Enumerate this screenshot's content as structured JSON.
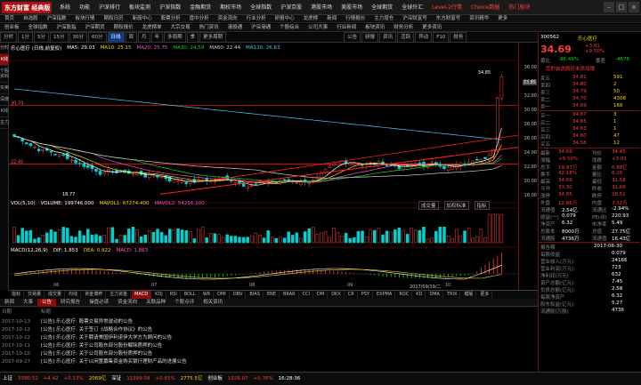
{
  "app": {
    "logo": "东方财富 经典版"
  },
  "menu": {
    "items": [
      "系统",
      "功能",
      "沪深排行",
      "板块监测",
      "沪深指数",
      "金融期货",
      "期权市场",
      "全球指数",
      "沪深京股",
      "港股市场",
      "美股市场",
      "全球期货",
      "全球外汇",
      "Level-2行情",
      "Choice数据",
      "热门版块"
    ],
    "system_items": [
      "选股器",
      "设置",
      "至尊版"
    ]
  },
  "nav": {
    "row1": [
      "首页",
      "自选股",
      "沪深指数",
      "板块行情",
      "期权日历",
      "新股中心",
      "股票分析",
      "盘中分析",
      "资金流向",
      "行业分析",
      "研报中心",
      "龙虎榜",
      "新闻",
      "行情报价",
      "主力增仓",
      "沪深财富号",
      "东方财富号",
      "资讯精华",
      "更多"
    ],
    "row2": [
      "创业板",
      "全球指数",
      "沪深股指",
      "沪深期货",
      "期权报价",
      "龙虎榜单",
      "大宗交易",
      "热门资讯",
      "港股通",
      "沪深港通",
      "个股综合",
      "公司大事",
      "行业新闻",
      "板块资讯",
      "财务分析",
      "更多资讯"
    ]
  },
  "toolbar": {
    "items": [
      "分时",
      "1分",
      "5分",
      "15分",
      "30分",
      "60分",
      "日线",
      "周",
      "月",
      "年",
      "多周期",
      "季",
      "更多周期"
    ],
    "active": "日线",
    "search_tabs": [
      "公告",
      "研报",
      "资讯",
      "活跃",
      "异动",
      "F10",
      "财务"
    ]
  },
  "sidetabs": [
    "分时",
    "K线",
    "个股资料",
    "买卖",
    "深度",
    "K线",
    "主力"
  ],
  "legend": {
    "name": "乐心医疗 (日线,前复权)",
    "ma": [
      {
        "label": "MA5:",
        "value": "29.03"
      },
      {
        "label": "MA10:",
        "value": "25.15"
      },
      {
        "label": "MA20:",
        "value": "25.75"
      },
      {
        "label": "MA30:",
        "value": "24.59"
      },
      {
        "label": "MA60:",
        "value": "22.44"
      },
      {
        "label": "MA120:",
        "value": "26.63"
      }
    ]
  },
  "vol_legend": {
    "name": "VOL(5,10)",
    "vol": "VOLUME: 199746.000",
    "ma1": "MAVOL1: 67274.400",
    "ma2": "MAVOL2: 54256.100"
  },
  "macd_legend": {
    "name": "MACD(12,26,9)",
    "dif": "DIF: 1.853",
    "dea": "DEA: 0.922",
    "macd": "MACD: 1.863"
  },
  "price_axis": [
    "36.00",
    "34.00",
    "32.00",
    "30.00",
    "28.00",
    "26.00",
    "24.00",
    "22.00",
    "20.00",
    "18.00"
  ],
  "high_label": "34.85",
  "low_label": "18.77",
  "current_price_tag": "33.85",
  "red_line_labels": [
    "30.70",
    "22.45"
  ],
  "chart_date": "2017/09/19/二",
  "xaxis_labels": [
    "06",
    "07",
    "08",
    "09",
    "10"
  ],
  "btabs": [
    "指标",
    "交易量",
    "成交量",
    "均线",
    "资金博弈",
    "主力资金",
    "MACD",
    "KDJ",
    "RSI",
    "BOLL",
    "WR",
    "DMI",
    "OBV",
    "BIAS",
    "ENE",
    "BRAR",
    "CCI",
    "DM",
    "DKX",
    "CR",
    "PSY",
    "EXPMA",
    "ROC",
    "KD",
    "DMA",
    "TRIX",
    "模版",
    "更多"
  ],
  "sub_tabs_vol": [
    "成交量",
    "加权标准",
    "指标"
  ],
  "news_tabs": [
    "新闻",
    "大事",
    "公告",
    "研究报告",
    "操盘必读",
    "资金流向",
    "关联品种",
    "个股点评",
    "相关资讯"
  ],
  "news_active": "公告",
  "news_header": [
    "日期",
    "标题"
  ],
  "news": [
    {
      "date": "2017-10-13",
      "title": "[公告] 乐心医疗: 股票交易异常波动的公告"
    },
    {
      "date": "2017-10-12",
      "title": "[公告] 乐心医疗: 关于签订《战略合作协议》的公告"
    },
    {
      "date": "2017-10-12",
      "title": "[公告] 乐心医疗: 关于聘请美国伊利诺伊大学方为顾问的公告"
    },
    {
      "date": "2017-10-11",
      "title": "[公告] 乐心医疗: 关于公司股东部分股份解除质押的公告"
    },
    {
      "date": "2017-10-10",
      "title": "[公告] 乐心医疗: 关于公司股东部分股份质押的公告"
    },
    {
      "date": "2017-09-27",
      "title": "[公告] 乐心医疗: 关于以闲置募集资金购买银行理财产品的进展公告"
    }
  ],
  "stock": {
    "code": "300562",
    "name": "乐心医疗",
    "price": "34.69",
    "change": "+3.01",
    "pct": "+9.50%",
    "weibi_label": "委比",
    "weibi": "-96.49%",
    "weicha_label": "委差",
    "weicha": "-4678",
    "notice": "您的自选股还未添加哦",
    "asks": [
      {
        "label": "卖五",
        "price": "34.81",
        "vol": "591"
      },
      {
        "label": "卖四",
        "price": "34.80",
        "vol": "2"
      },
      {
        "label": "卖三",
        "price": "34.79",
        "vol": "50"
      },
      {
        "label": "卖二",
        "price": "34.70",
        "vol": "4308"
      },
      {
        "label": "卖一",
        "price": "34.69",
        "vol": "166"
      }
    ],
    "bids": [
      {
        "label": "买一",
        "price": "34.67",
        "vol": "3"
      },
      {
        "label": "买二",
        "price": "34.65",
        "vol": "1"
      },
      {
        "label": "买三",
        "price": "34.63",
        "vol": "1"
      },
      {
        "label": "买四",
        "price": "34.60",
        "vol": "47"
      },
      {
        "label": "买五",
        "price": "34.58",
        "vol": "12"
      }
    ],
    "stats": [
      [
        "最新",
        "34.69",
        "均价",
        "34.45"
      ],
      [
        "涨幅",
        "+9.50%",
        "涨跌",
        "+3.01"
      ],
      [
        "总手",
        "19.97万",
        "金额",
        "6.88亿"
      ],
      [
        "换手",
        "42.18%",
        "量比",
        "6.20"
      ],
      [
        "最高",
        "34.69",
        "最低",
        "31.58"
      ],
      [
        "今开",
        "33.30",
        "昨收",
        "31.68"
      ],
      [
        "涨停",
        "34.85",
        "跌停",
        "28.51"
      ],
      [
        "外盘",
        "12.66万",
        "内盘",
        "7.32万"
      ]
    ],
    "fin": [
      [
        "流通值",
        "2.54亿",
        "流通比",
        "-2.94%"
      ],
      [
        "收益(一)",
        "0.079",
        "PE(动)",
        "220.93"
      ],
      [
        "净资产",
        "6.32",
        "市净率",
        "5.49"
      ],
      [
        "总股本",
        "8000万",
        "总值",
        "27.75亿"
      ],
      [
        "流通股",
        "4736万",
        "流通值",
        "16.43亿"
      ]
    ],
    "report_date_label": "报告期",
    "report_date": "2017-06-30",
    "fin2": [
      [
        "每股收益",
        "0.079"
      ],
      [
        "营业收入(万元)",
        "24166"
      ],
      [
        "营业利润(万元)",
        "723"
      ],
      [
        "净利润(万元)",
        "632"
      ],
      [
        "资产总额(亿元)",
        "7.45"
      ],
      [
        "负债总额(亿元)",
        "2.58"
      ],
      [
        "每股净资产",
        "6.32"
      ],
      [
        "股东权益(亿元)",
        "5.27"
      ],
      [
        "流通股(万股)",
        "4736"
      ]
    ]
  },
  "status": [
    {
      "t": "上证",
      "c": "wht"
    },
    {
      "t": "3390.52",
      "c": "red"
    },
    {
      "t": "+4.42",
      "c": "red"
    },
    {
      "t": "+0.13%",
      "c": "red"
    },
    {
      "t": "2069亿",
      "c": "yel"
    },
    {
      "t": "深证",
      "c": "wht"
    },
    {
      "t": "11399.09",
      "c": "red"
    },
    {
      "t": "+0.81%",
      "c": "red"
    },
    {
      "t": "2775.5亿",
      "c": "yel"
    },
    {
      "t": "创业板",
      "c": "wht"
    },
    {
      "t": "1926.07",
      "c": "red"
    },
    {
      "t": "+0.76%",
      "c": "red"
    },
    {
      "t": "16:28:36",
      "c": "wht"
    }
  ],
  "colors": {
    "up": "#ff3b3b",
    "down": "#17d717",
    "accent": "#b01010",
    "ma5": "#ffffff",
    "ma10": "#ffd400",
    "ma20": "#ff4fd1",
    "ma30": "#17d717",
    "ma60": "#cfcfcf",
    "ma120": "#4fc3ff"
  }
}
